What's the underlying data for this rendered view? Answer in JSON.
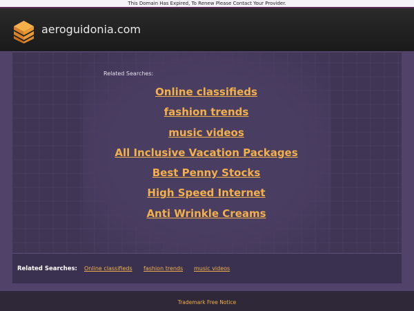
{
  "notice": "This Domain Has Expired, To Renew Please Contact Your Provider.",
  "header": {
    "site_name": "aeroguidonia.com",
    "logo_icon": "stacked-layers-icon"
  },
  "main": {
    "related_heading": "Related Searches:",
    "links": [
      "Online classifieds",
      "fashion trends",
      "music videos",
      "All Inclusive Vacation Packages",
      "Best Penny Stocks",
      "High Speed Internet",
      "Anti Wrinkle Creams"
    ]
  },
  "bottom_bar": {
    "label": "Related Searches:",
    "links": [
      "Online classifieds",
      "fashion trends",
      "music videos"
    ]
  },
  "footer": {
    "link": "Trademark Free Notice"
  },
  "colors": {
    "link": "#f2b04a",
    "background": "#51426a",
    "header": "#1f1f1f"
  }
}
